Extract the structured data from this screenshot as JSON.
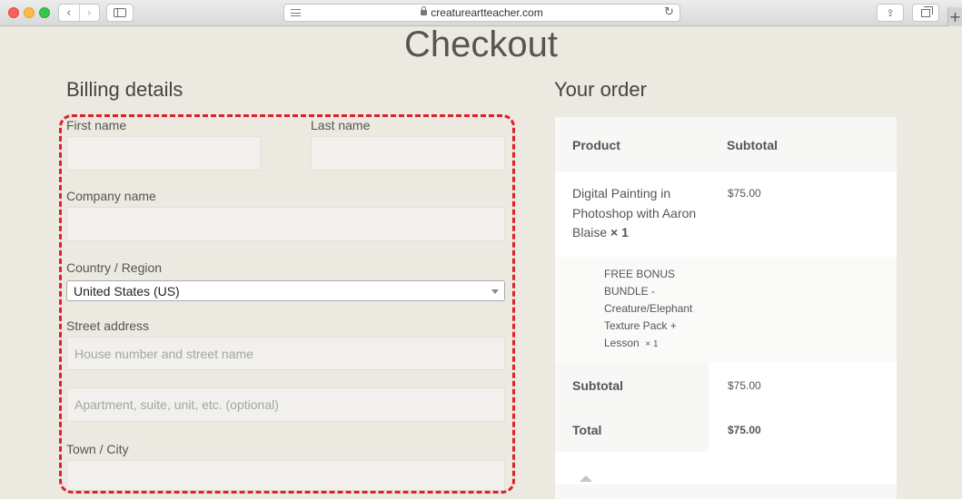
{
  "browser": {
    "url": "creatureartteacher.com",
    "back_glyph": "‹",
    "forward_glyph": "›",
    "reload_glyph": "↻",
    "share_glyph": "⇪",
    "newtab_glyph": "+"
  },
  "page": {
    "title": "Checkout",
    "billing_title": "Billing details",
    "order_title": "Your order"
  },
  "billing": {
    "first_name_label": "First name",
    "first_name_value": "",
    "last_name_label": "Last name",
    "last_name_value": "",
    "company_label": "Company name",
    "company_value": "",
    "country_label": "Country / Region",
    "country_value": "United States (US)",
    "street_label": "Street address",
    "street_placeholder": "House number and street name",
    "street2_placeholder": "Apartment, suite, unit, etc. (optional)",
    "city_label": "Town / City",
    "city_value": ""
  },
  "order": {
    "header_product": "Product",
    "header_subtotal": "Subtotal",
    "item": {
      "name_line1": "Digital Painting in",
      "name_line2": "Photoshop with Aaron",
      "name_line3": "Blaise",
      "qty": "× 1",
      "price": "$75.00"
    },
    "bonus": {
      "line1": "FREE BONUS",
      "line2": "BUNDLE -",
      "line3": "Creature/Elephant",
      "line4": "Texture Pack +",
      "line5": "Lesson",
      "qty": "× 1"
    },
    "subtotal_label": "Subtotal",
    "subtotal_value": "$75.00",
    "total_label": "Total",
    "total_value": "$75.00"
  },
  "colors": {
    "page_background": "#ebe9e0",
    "highlight_border": "#e0202a"
  }
}
